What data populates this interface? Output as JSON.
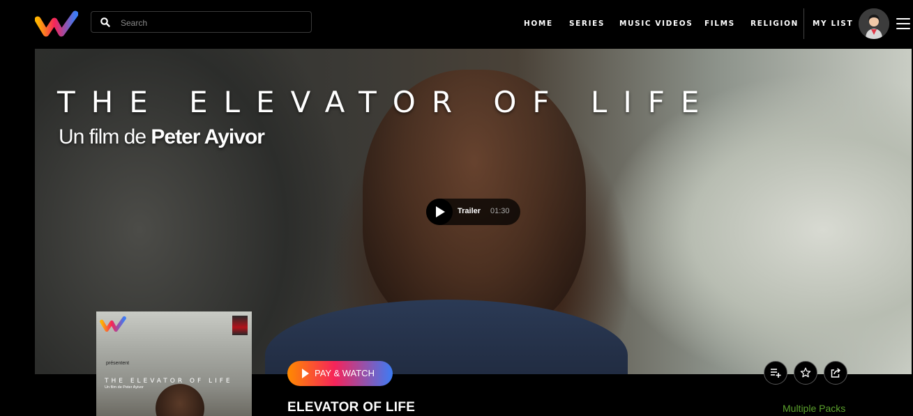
{
  "header": {
    "search": {
      "placeholder": "Search",
      "value": ""
    },
    "nav": [
      {
        "label": "HOME"
      },
      {
        "label": "SERIES"
      },
      {
        "label": "MUSIC VIDEOS"
      },
      {
        "label": "FILMS"
      },
      {
        "label": "RELIGION"
      },
      {
        "label": "MY LIST"
      }
    ]
  },
  "hero": {
    "title": "THE ELEVATOR OF LIFE",
    "subtitle_prefix": "Un film de ",
    "subtitle_name": "Peter Ayivor",
    "trailer": {
      "label": "Trailer",
      "duration": "01:30"
    }
  },
  "poster": {
    "presents": "présentent",
    "title": "THE ELEVATOR OF LIFE",
    "subtitle": "Un film de Peter Ayivor"
  },
  "actions": {
    "pay_label": "PAY & WATCH",
    "icons": [
      "add-to-playlist-icon",
      "star-icon",
      "share-icon"
    ]
  },
  "movie": {
    "title": "ELEVATOR OF LIFE",
    "packs": "Multiple Packs"
  },
  "colors": {
    "background": "#000000",
    "accent_orange": "#ff8a00",
    "accent_pink": "#f5245a",
    "accent_blue": "#3c7cf5",
    "packs_green": "#5aa02c"
  }
}
